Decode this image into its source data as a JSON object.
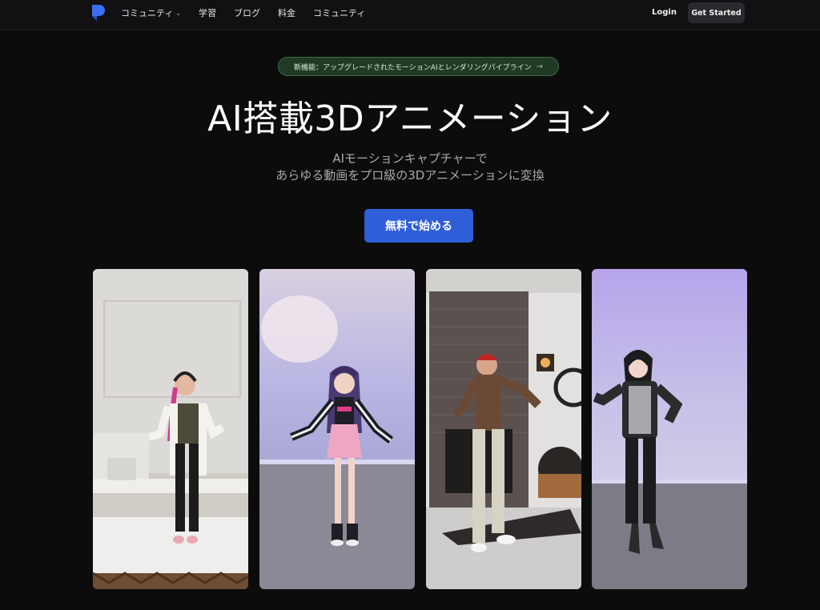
{
  "nav": {
    "items": [
      {
        "label": "コミュニティ",
        "has_dropdown": true
      },
      {
        "label": "学習"
      },
      {
        "label": "ブログ"
      },
      {
        "label": "料金"
      },
      {
        "label": "コミュニティ"
      }
    ],
    "login_label": "Login",
    "get_started_label": "Get Started",
    "chevron_icon": "chevron-down-icon"
  },
  "hero": {
    "badge_text": "新機能：アップグレードされたモーションAIとレンダリングパイプライン",
    "badge_arrow": "→",
    "headline": "AI搭載3Dアニメーション",
    "subline_1": "AIモーションキャプチャーで",
    "subline_2": "あらゆる動画をプロ級の3Dアニメーションに変換",
    "cta_label": "無料で始める"
  },
  "colors": {
    "background": "#0c0c0d",
    "badge_bg": "#1f3a25",
    "cta": "#2f5fd8",
    "logo": "#3b6ef5"
  }
}
